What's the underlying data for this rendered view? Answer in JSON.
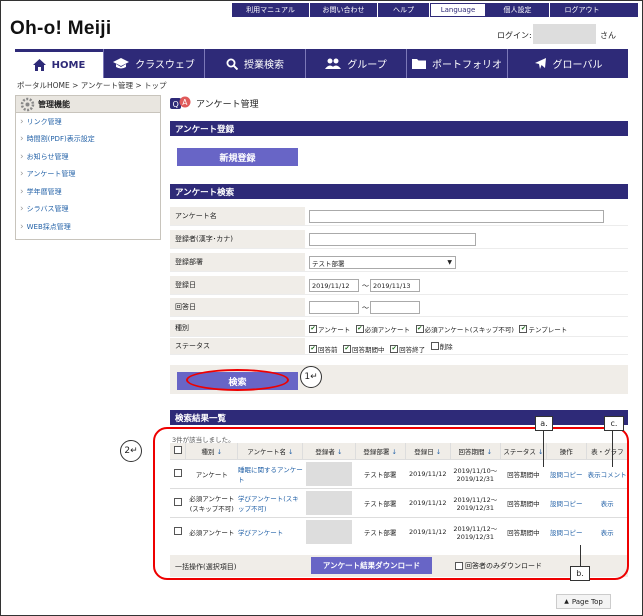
{
  "header": {
    "util_links": [
      "利用マニュアル",
      "お問い合わせ",
      "ヘルプ",
      "Language",
      "個人設定",
      "ログアウト"
    ],
    "logo": "Oh-o! Meiji",
    "login_label": "ログイン:",
    "login_suffix": "さん"
  },
  "nav": {
    "items": [
      "HOME",
      "クラスウェブ",
      "授業検索",
      "グループ",
      "ポートフォリオ",
      "グローバル"
    ]
  },
  "breadcrumb": "ポータルHOME > アンケート管理 > トップ",
  "sidebar": {
    "title": "管理機能",
    "items": [
      "リンク管理",
      "時間割(PDF)表示設定",
      "お知らせ管理",
      "アンケート管理",
      "学年暦管理",
      "シラバス管理",
      "WEB採点管理"
    ]
  },
  "page_title": "アンケート管理",
  "register": {
    "section": "アンケート登録",
    "button": "新規登録"
  },
  "search": {
    "section": "アンケート検索",
    "name_label": "アンケート名",
    "registrant_label": "登録者(漢字･カナ)",
    "dept_label": "登録部署",
    "dept_value": "テスト部署",
    "regdate_label": "登録日",
    "regdate_from": "2019/11/12",
    "regdate_to": "2019/11/13",
    "range_sep": "〜",
    "answer_label": "回答日",
    "type_label": "種別",
    "types": [
      "アンケート",
      "必須アンケート",
      "必須アンケート(スキップ不可)",
      "テンプレート"
    ],
    "status_label": "ステータス",
    "statuses": [
      "回答前",
      "回答期間中",
      "回答終了",
      "削除"
    ],
    "status_checked": [
      true,
      true,
      true,
      false
    ],
    "button": "検索"
  },
  "results": {
    "section": "検索結果一覧",
    "count_text": "3件が該当しました。",
    "columns": [
      "種別",
      "アンケート名",
      "登録者",
      "登録部署",
      "登録日",
      "回答期間",
      "ステータス",
      "操作",
      "表・グラフ"
    ],
    "rows": [
      {
        "type": "アンケート",
        "name": "睡眠に関するアンケート",
        "dept": "テスト部署",
        "date": "2019/11/12",
        "period": "2019/11/10～2019/12/31",
        "status": "回答期間中",
        "op": "設問コピー",
        "view": "表示",
        "comment": "コメント"
      },
      {
        "type": "必須アンケート(スキップ不可)",
        "name": "学びアンケート(スキップ不可)",
        "dept": "テスト部署",
        "date": "2019/11/12",
        "period": "2019/11/12～2019/12/31",
        "status": "回答期間中",
        "op": "設問コピー",
        "view": "表示",
        "comment": ""
      },
      {
        "type": "必須アンケート",
        "name": "学びアンケート",
        "dept": "テスト部署",
        "date": "2019/11/12",
        "period": "2019/11/12～2019/12/31",
        "status": "回答期間中",
        "op": "設問コピー",
        "view": "表示",
        "comment": ""
      }
    ],
    "bulk_label": "一括操作(選択項目)",
    "download_button": "アンケート結果ダウンロード",
    "download_option": "回答者のみダウンロード"
  },
  "annotations": {
    "callout1": "1",
    "callout2": "2",
    "a": "a.",
    "b": "b.",
    "c": "c."
  },
  "page_top": "Page Top",
  "colors": {
    "brand": "#2e2a78",
    "button": "#6865c6",
    "annotation": "#e00000"
  }
}
